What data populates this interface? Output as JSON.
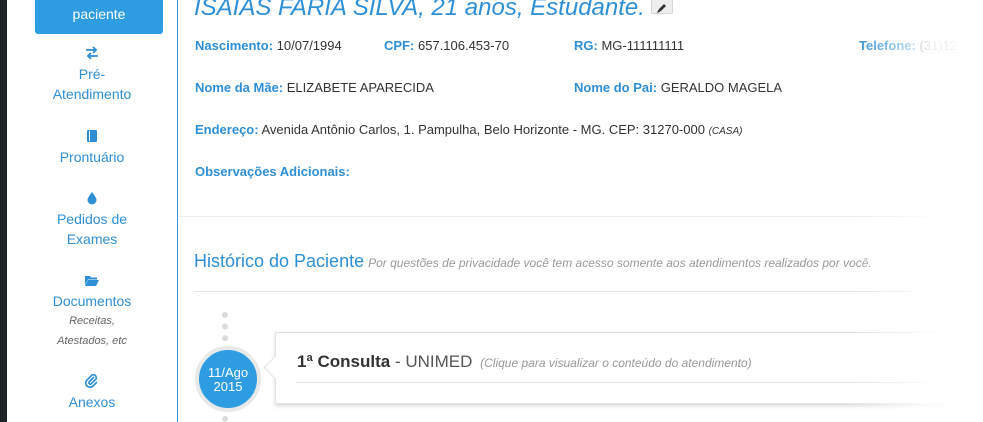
{
  "sidebar": {
    "top_button": "paciente",
    "items": [
      {
        "icon": "exchange-icon",
        "label": "Pré-\nAtendimento"
      },
      {
        "icon": "book-icon",
        "label": "Prontuário"
      },
      {
        "icon": "drop-icon",
        "label": "Pedidos de Exames"
      },
      {
        "icon": "folder-open-icon",
        "label": "Documentos",
        "sub": "Receitas, Atestados, etc"
      },
      {
        "icon": "paperclip-icon",
        "label": "Anexos"
      }
    ]
  },
  "patient": {
    "title": "ISAIAS FARIA SILVA, 21 anos, Estudante.",
    "nascimento_label": "Nascimento:",
    "nascimento": "10/07/1994",
    "cpf_label": "CPF:",
    "cpf": "657.106.453-70",
    "rg_label": "RG:",
    "rg": "MG-111111111",
    "telefone_label": "Telefone:",
    "telefone": "(31)12",
    "mae_label": "Nome da Mãe:",
    "mae": "ELIZABETE APARECIDA",
    "pai_label": "Nome do Pai:",
    "pai": "GERALDO MAGELA",
    "endereco_label": "Endereço:",
    "endereco": "Avenida Antônio Carlos, 1. Pampulha, Belo Horizonte - MG. CEP: 31270-000",
    "endereco_tipo": "(CASA)",
    "obs_label": "Observações Adicionais:",
    "obs": ""
  },
  "historico": {
    "title": "Histórico do Paciente",
    "note": "Por questões de privacidade você tem acesso somente aos atendimentos realizados por você.",
    "entries": [
      {
        "date_line1": "11/Ago",
        "date_line2": "2015",
        "title": "1ª Consulta",
        "separator": "-",
        "insurer": "UNIMED",
        "hint": "(Clique para visualizar o conteúdo do atendimento)"
      }
    ]
  },
  "colors": {
    "accent": "#2e9ce0",
    "link": "#2e8fd6",
    "sidebar_edge": "#1f2428"
  }
}
